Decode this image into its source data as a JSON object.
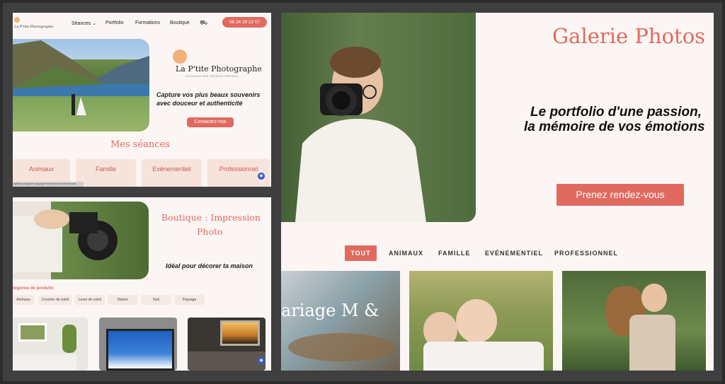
{
  "panelA": {
    "logo_small": "La P'tite Photographe",
    "nav": [
      "Séances",
      "Portfolio",
      "Formations",
      "Boutique"
    ],
    "phone": "06 34 29 22 07",
    "logo_big": "La P'tite Photographe",
    "logo_tagline": "SOUVENIRS DES INSTANTS PRÉCIEUX",
    "headline_line1": "Capture vos plus beaux souvenirs",
    "headline_line2": "avec douceur et authenticité",
    "cta": "Contactez-moi",
    "section_title": "Mes séances",
    "cards": [
      "Animaux",
      "Famille",
      "Evénementiel",
      "Professionnel"
    ],
    "footer_text": "laptitephotographe copyright mesfiseances professionnel"
  },
  "panelB": {
    "title_line1": "Boutique : Impression",
    "title_line2": "Photo",
    "subtitle": "Idéal pour décorer ta maison",
    "categories_label": "tegories de produits",
    "chips": [
      "Animaux",
      "Coucher de soleil",
      "Lever de soleil",
      "Nature",
      "Nuit",
      "Paysage"
    ]
  },
  "panelC": {
    "title": "Galerie Photos",
    "tagline_line1": "Le portfolio d'une passion,",
    "tagline_line2": "la mémoire de vos émotions",
    "cta": "Prenez rendez-vous",
    "tabs": [
      "TOUT",
      "ANIMAUX",
      "FAMILLE",
      "EVÉNEMENTIEL",
      "PROFESSIONNEL"
    ],
    "gallery_caption": "ariage M &"
  },
  "colors": {
    "accent": "#e06a5f",
    "cream": "#fbf6f3",
    "frame": "#3f3f3f"
  }
}
